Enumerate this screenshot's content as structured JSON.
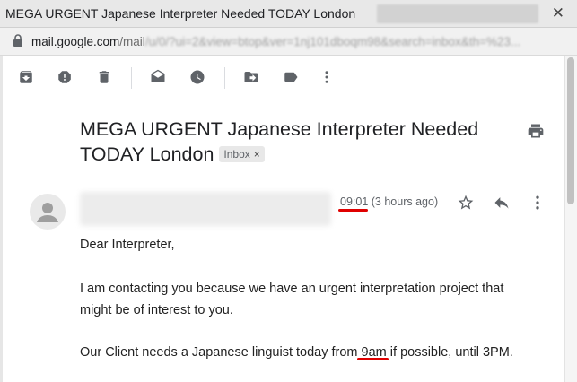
{
  "window": {
    "title": "MEGA URGENT Japanese Interpreter Needed TODAY London",
    "close_glyph": "✕"
  },
  "urlbar": {
    "host": "mail.google.com",
    "path": "/mail",
    "obscured": "/u/0/?ui=2&view=btop&ver=1nj101dboqm98&search=inbox&th=%23..."
  },
  "toolbar": {
    "icons": [
      "archive-icon",
      "report-spam-icon",
      "delete-icon",
      "mark-unread-icon",
      "snooze-icon",
      "move-to-icon",
      "labels-icon",
      "more-vert-icon"
    ]
  },
  "email": {
    "subject_line1": "MEGA URGENT Japanese Interpreter Needed",
    "subject_line2": "TODAY London",
    "label": "Inbox",
    "label_remove": "×",
    "time": "09:01",
    "time_ago": "(3 hours ago)",
    "body": {
      "greeting": "Dear Interpreter,",
      "para1_line1": "I am contacting you because we have an urgent interpretation project that",
      "para1_line2": "might be of interest to you.",
      "para2_before": "Our Client needs a Japanese linguist today from ",
      "para2_highlight": "9am",
      "para2_after": " if possible, until 3PM."
    }
  },
  "annotations": {
    "underline_color": "#e00000"
  }
}
